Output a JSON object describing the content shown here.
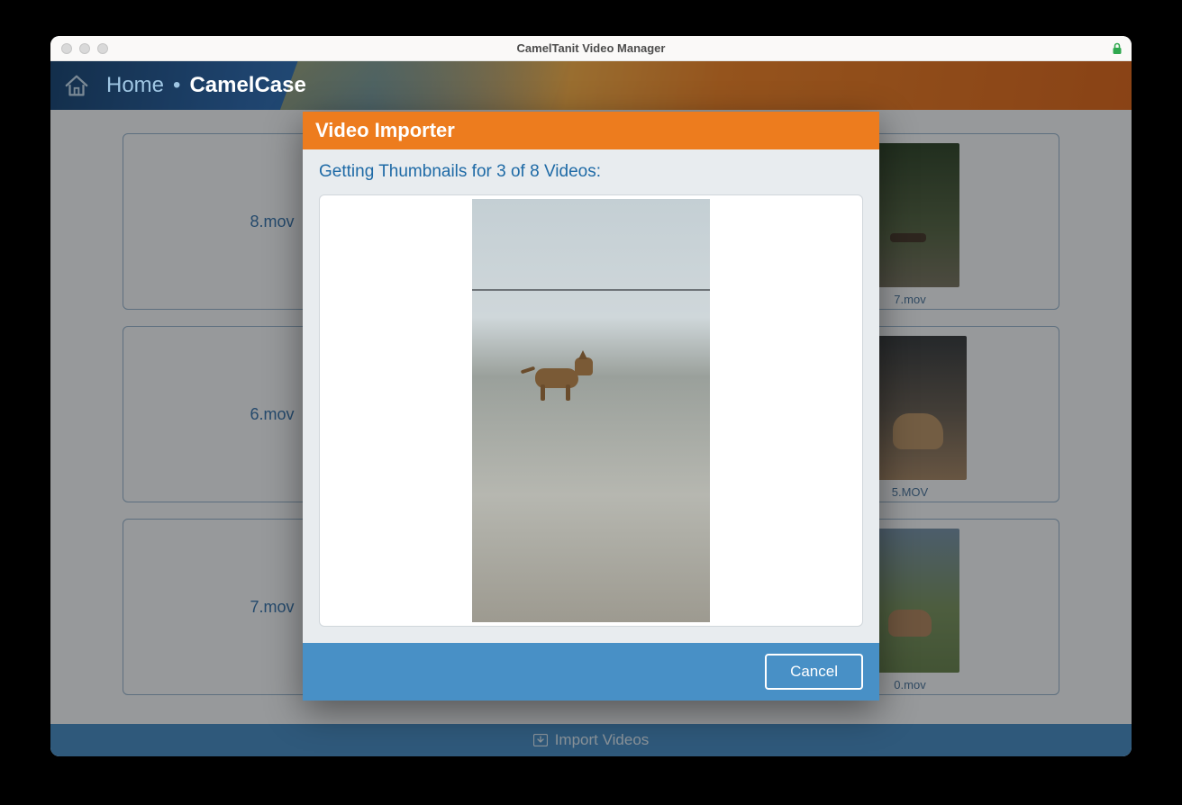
{
  "window": {
    "title": "CamelTanit Video Manager"
  },
  "header": {
    "home_link": "Home",
    "separator": "•",
    "current": "CamelCase"
  },
  "grid": {
    "items": [
      {
        "label": "8.mov",
        "has_thumb": false
      },
      {
        "label": "",
        "has_thumb": false
      },
      {
        "label": "7.mov",
        "has_thumb": true,
        "thumb_class": "t1"
      },
      {
        "label": "6.mov",
        "has_thumb": false
      },
      {
        "label": "",
        "has_thumb": false
      },
      {
        "label": "5.MOV",
        "has_thumb": true,
        "thumb_class": "t2"
      },
      {
        "label": "7.mov",
        "has_thumb": false
      },
      {
        "label": "",
        "has_thumb": false
      },
      {
        "label": "0.mov",
        "has_thumb": true,
        "thumb_class": "t3"
      }
    ]
  },
  "footer": {
    "import_label": "Import Videos"
  },
  "modal": {
    "title": "Video Importer",
    "status": "Getting Thumbnails for 3 of 8 Videos:",
    "cancel_label": "Cancel",
    "progress_current": 3,
    "progress_total": 8
  }
}
